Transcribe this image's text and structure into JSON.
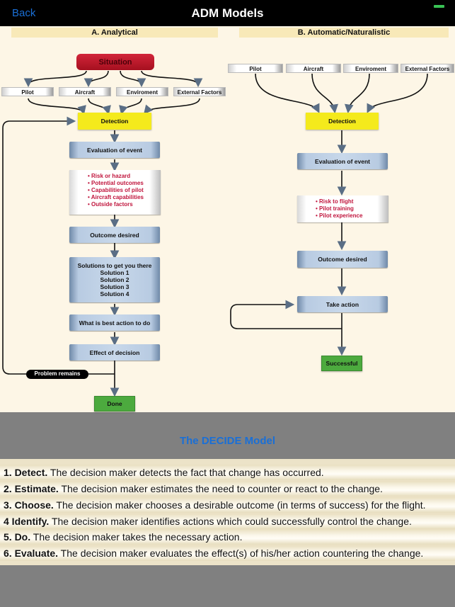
{
  "navbar": {
    "back_label": "Back",
    "title": "ADM Models",
    "battery_color": "#39c254"
  },
  "analytical": {
    "heading": "A. Analytical",
    "situation": "Situation",
    "factors": [
      "Pilot",
      "Aircraft",
      "Enviroment",
      "External Factors"
    ],
    "detection": "Detection",
    "evaluation": "Evaluation of event",
    "considerations": [
      "Risk or hazard",
      "Potential outcomes",
      "Capabilities of pilot",
      "Aircraft capabilities",
      "Outside factors"
    ],
    "outcome": "Outcome desired",
    "solutions": [
      "Solutions to get you there",
      "Solution 1",
      "Solution 2",
      "Solution 3",
      "Solution 4"
    ],
    "best_action": "What is best action to do",
    "effect": "Effect of decision",
    "problem_remains": "Problem remains",
    "done": "Done"
  },
  "naturalistic": {
    "heading": "B. Automatic/Naturalistic",
    "factors": [
      "Pilot",
      "Aircraft",
      "Enviroment",
      "External Factors"
    ],
    "detection": "Detection",
    "evaluation": "Evaluation of event",
    "considerations": [
      "Risk to flight",
      "Pilot training",
      "Pilot experience"
    ],
    "outcome": "Outcome desired",
    "take_action": "Take action",
    "successful": "Successful"
  },
  "decide": {
    "title": "The DECIDE Model",
    "steps": [
      {
        "label": "1. Detect.",
        "text": " The decision maker detects the fact that change has occurred."
      },
      {
        "label": "2. Estimate.",
        "text": " The decision maker estimates the need to counter or react to the change."
      },
      {
        "label": "3. Choose.",
        "text": " The decision maker chooses a desirable outcome (in terms of success) for the flight."
      },
      {
        "label": "4  Identify.",
        "text": " The decision maker identifies actions which could successfully control the change."
      },
      {
        "label": "5. Do.",
        "text": " The decision maker takes the necessary action."
      },
      {
        "label": "6. Evaluate.",
        "text": " The decision maker evaluates the effect(s) of his/her action countering the change."
      }
    ]
  }
}
